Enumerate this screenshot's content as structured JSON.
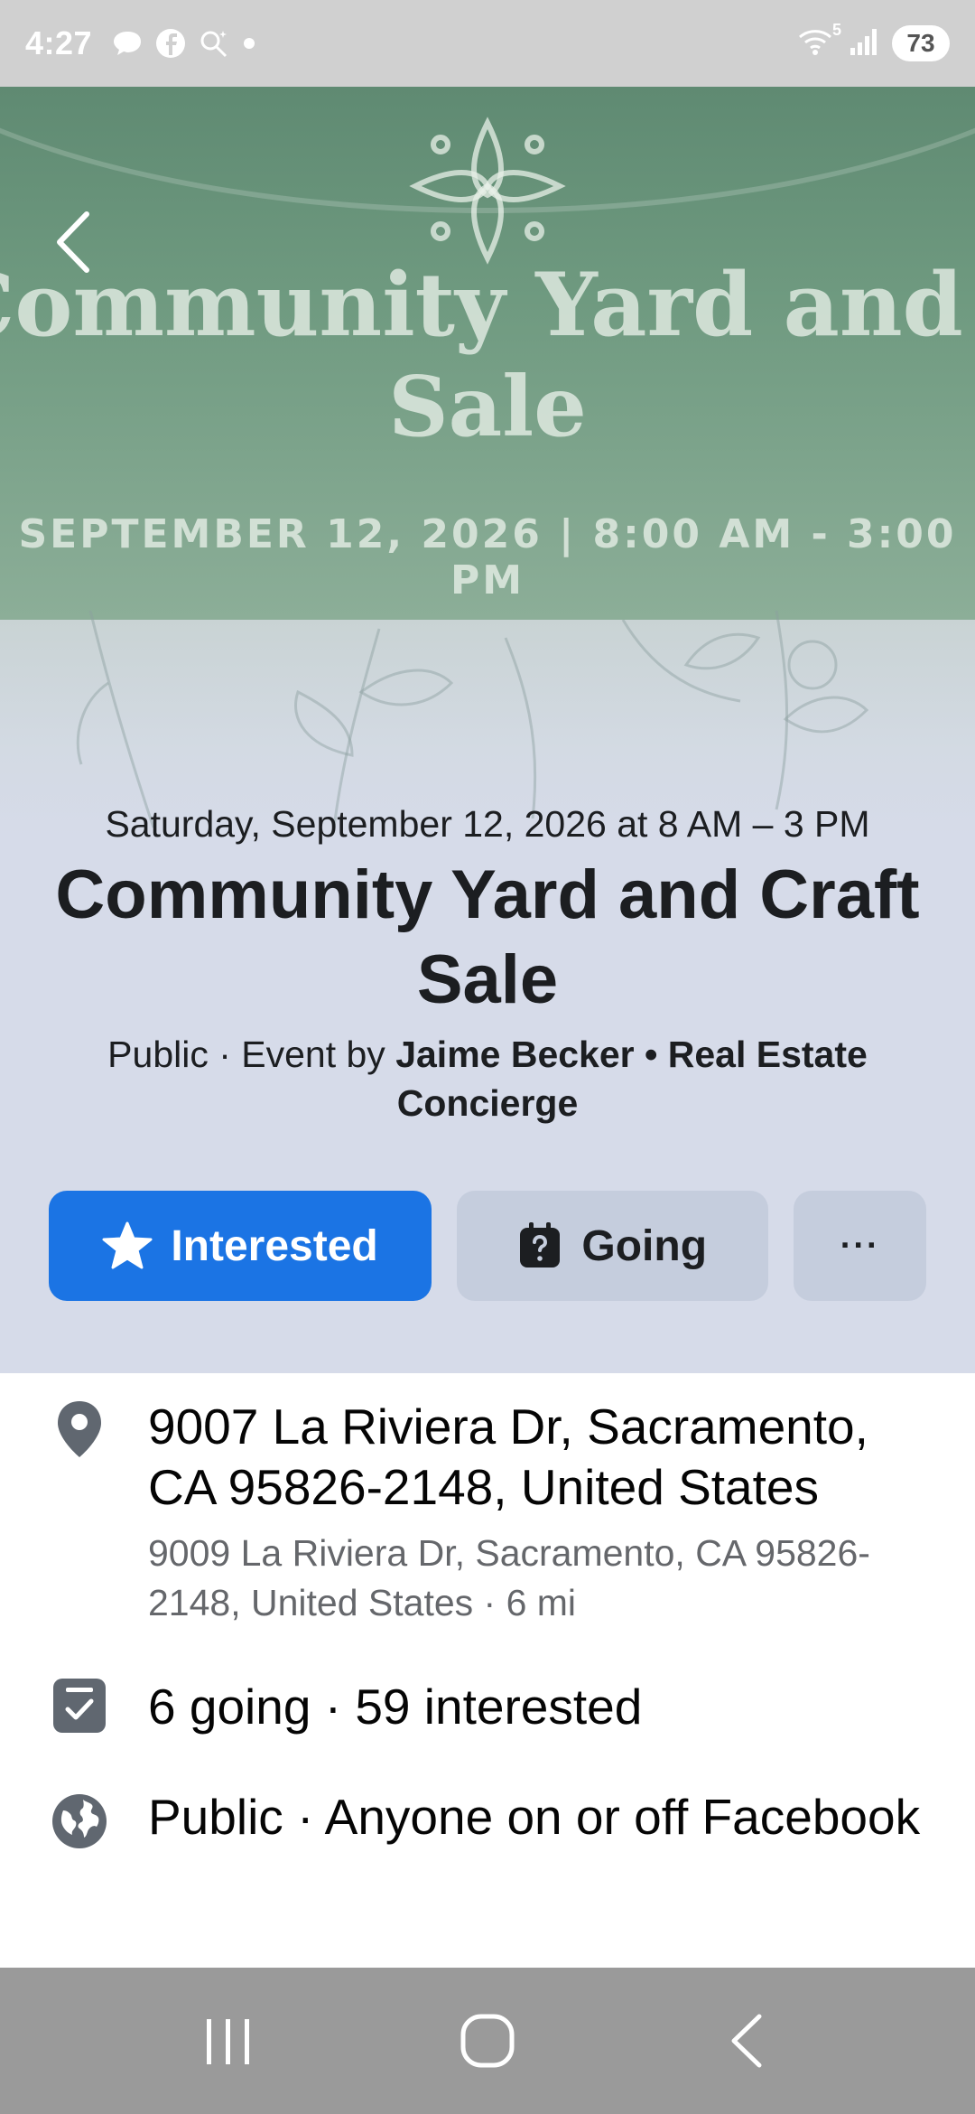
{
  "status_bar": {
    "time": "4:27",
    "battery": "73",
    "wifi_badge": "5"
  },
  "cover": {
    "title_line1": "Community Yard and Craft",
    "title_line2": "Sale",
    "date_line": "SEPTEMBER 12, 2026 | 8:00 AM - 3:00 PM"
  },
  "event": {
    "date": "Saturday, September 12, 2026 at 8 AM – 3 PM",
    "title": "Community Yard and Craft Sale",
    "host_prefix": "Public · Event by ",
    "host_name": "Jaime Becker • Real Estate Concierge"
  },
  "actions": {
    "interested_label": "Interested",
    "going_label": "Going",
    "more_label": "···"
  },
  "details": {
    "location": "9007 La Riviera Dr, Sacramento, CA 95826-2148, United States",
    "location_sub": "9009 La Riviera Dr, Sacramento, CA 95826-2148, United States · 6 mi",
    "attendance": "6 going · 59 interested",
    "privacy": "Public · Anyone on or off Facebook"
  },
  "colors": {
    "accent": "#1b74e4",
    "hero_bg": "#d6dbe9",
    "secondary_button": "#c5cddd",
    "text_primary": "#050505",
    "text_secondary": "#65676b"
  },
  "icons": {
    "back": "chevron-left-icon",
    "interested": "star-icon",
    "going": "question-calendar-icon",
    "location": "map-pin-icon",
    "attendance": "calendar-check-icon",
    "privacy": "globe-icon"
  }
}
